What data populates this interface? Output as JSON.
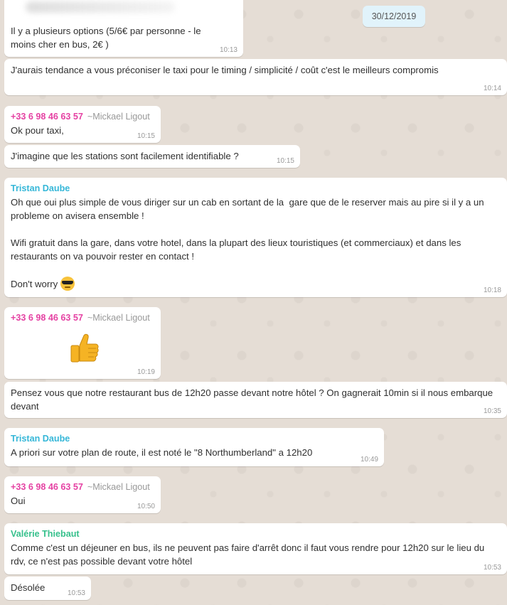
{
  "date_badge": "30/12/2019",
  "messages": [
    {
      "sender": "",
      "text": "Il y a plusieurs options (5/6€ par personne - le moins cher en bus, 2€ )",
      "time": "10:13"
    },
    {
      "sender": "",
      "text": "J'aurais tendance a vous préconiser le taxi pour le timing / simplicité / coût c'est le meilleurs compromis",
      "time": "10:14"
    },
    {
      "sender": "+33 6 98 46 63 57",
      "sender_name": "~Mickael Ligout",
      "text": "Ok pour taxi,",
      "time": "10:15"
    },
    {
      "sender": "",
      "text": "J'imagine que les stations sont facilement identifiable ?",
      "time": "10:15"
    },
    {
      "sender": "Tristan Daube",
      "text": "Oh que oui plus simple de vous diriger sur un cab en sortant de la  gare que de le reserver mais au pire si il y a un probleme on avisera ensemble !\n\nWifi gratuit dans la gare, dans votre hotel, dans la plupart des lieux touristiques (et commerciaux) et dans les restaurants on va pouvoir rester en contact !\n\nDon't worry",
      "emoji": "smiling-face-with-sunglasses",
      "time": "10:18"
    },
    {
      "sender": "+33 6 98 46 63 57",
      "sender_name": "~Mickael Ligout",
      "emoji": "thumbs-up",
      "time": "10:19"
    },
    {
      "sender": "",
      "text": "Pensez vous que notre restaurant bus de 12h20 passe devant notre hôtel ? On gagnerait 10min si il nous embarque devant",
      "time": "10:35"
    },
    {
      "sender": "Tristan Daube",
      "text": "A priori sur votre plan de route, il est noté le \"8 Northumberland\" a 12h20",
      "time": "10:49"
    },
    {
      "sender": "+33 6 98 46 63 57",
      "sender_name": "~Mickael Ligout",
      "text": "Oui",
      "time": "10:50"
    },
    {
      "sender": "Valérie Thiebaut",
      "text": "Comme c'est un déjeuner en bus, ils ne peuvent pas faire d'arrêt donc il faut vous rendre pour 12h20 sur le lieu du rdv, ce n'est pas possible devant votre hôtel",
      "time": "10:53"
    },
    {
      "sender": "",
      "text": "Désolée",
      "time": "10:53"
    }
  ],
  "colors": {
    "background": "#e5ddd5",
    "bubble": "#ffffff",
    "date_badge": "#e1f3fb",
    "pink": "#e542a3",
    "blue": "#35b7d8",
    "green": "#36c08c"
  }
}
